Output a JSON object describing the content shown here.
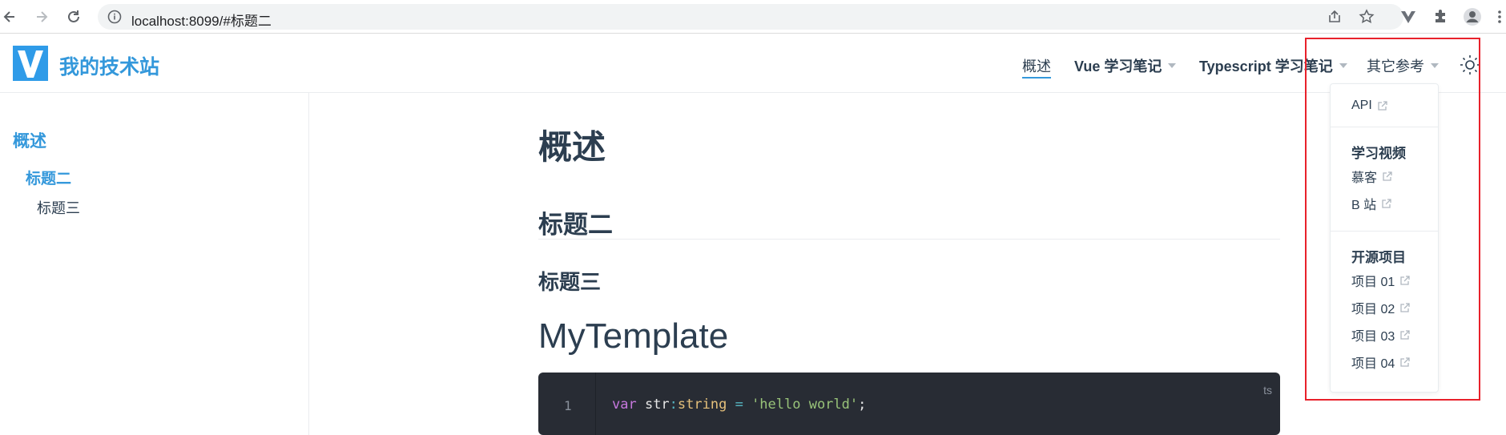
{
  "browser": {
    "url": "localhost:8099/#标题二",
    "icons": [
      "back-icon",
      "forward-icon",
      "reload-icon",
      "info-icon",
      "share-icon",
      "star-icon",
      "vue-extension-icon",
      "puzzle-icon",
      "profile-icon",
      "more-icon"
    ]
  },
  "navbar": {
    "site_name": "我的技术站",
    "items": [
      {
        "label": "概述",
        "active": true
      },
      {
        "label": "Vue 学习笔记"
      },
      {
        "label": "Typescript 学习笔记"
      },
      {
        "label": "其它参考"
      }
    ]
  },
  "sidebar": {
    "title": "概述",
    "h2": "标题二",
    "h3": "标题三"
  },
  "content": {
    "h1": "概述",
    "h2": "标题二",
    "h3": "标题三",
    "h_tpl": "MyTemplate",
    "code": {
      "lang": "ts",
      "line_no": "1",
      "tokens": {
        "kw": "var",
        "name": " str",
        "colon": ":",
        "type": "string",
        "eq": " = ",
        "str": "'hello world'",
        "semi": ";"
      }
    }
  },
  "dropdown": {
    "api": "API",
    "group1": "学习视频",
    "group1_items": [
      "慕客",
      "B 站"
    ],
    "group2": "开源项目",
    "group2_items": [
      "项目 01",
      "项目 02",
      "项目 03",
      "项目 04"
    ]
  },
  "colors": {
    "accent": "#3498db",
    "text": "#2c3e50",
    "highlight": "#e8212b",
    "code_bg": "#282c34"
  }
}
